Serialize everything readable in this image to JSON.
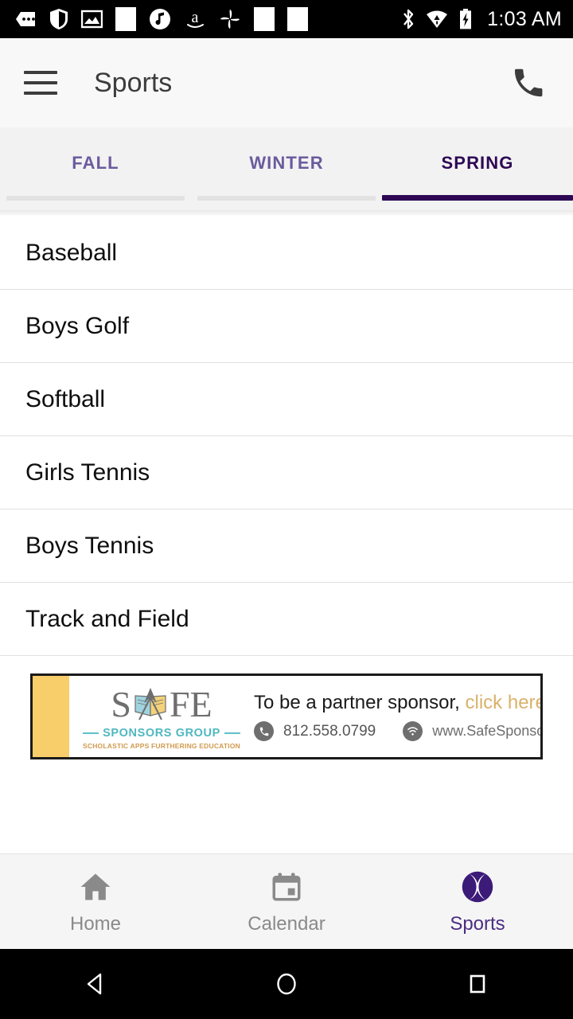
{
  "status_bar": {
    "time": "1:03 AM",
    "left_icons": [
      {
        "name": "messages-icon"
      },
      {
        "name": "shield-icon"
      },
      {
        "name": "photo-icon"
      },
      {
        "name": "blank-app-icon"
      },
      {
        "name": "music-note-icon"
      },
      {
        "name": "amazon-icon"
      },
      {
        "name": "pinwheel-photos-icon"
      },
      {
        "name": "blank-app-icon-2"
      },
      {
        "name": "blank-app-icon-3"
      }
    ],
    "right_icons": [
      {
        "name": "bluetooth-icon"
      },
      {
        "name": "wifi-alert-icon"
      },
      {
        "name": "battery-charging-icon"
      }
    ]
  },
  "appbar": {
    "menu_icon": "hamburger-menu-icon",
    "title": "Sports",
    "phone_icon": "phone-icon"
  },
  "tabs": {
    "items": [
      {
        "label": "FALL",
        "active": false
      },
      {
        "label": "WINTER",
        "active": false
      },
      {
        "label": "SPRING",
        "active": true
      }
    ],
    "active_color": "#2E0854",
    "inactive_color": "#6B5B9E"
  },
  "sports_list": [
    {
      "label": "Baseball"
    },
    {
      "label": "Boys Golf"
    },
    {
      "label": "Softball"
    },
    {
      "label": "Girls Tennis"
    },
    {
      "label": "Boys Tennis"
    },
    {
      "label": "Track and Field"
    }
  ],
  "ad": {
    "logo": {
      "letter_s": "S",
      "letter_f": "F",
      "letter_e": "E",
      "book_icon": "open-book-icon",
      "subtitle": "SPONSORS GROUP",
      "tagline": "SCHOLASTIC APPS FURTHERING EDUCATION"
    },
    "headline_main": "To be a partner sponsor,",
    "headline_cta": "click here!",
    "phone": "812.558.0799",
    "website": "www.SafeSponsors.com",
    "phone_icon": "phone-circle-icon",
    "wifi_icon": "wifi-circle-icon",
    "left_bar_color": "#F8CE6B",
    "right_bar_color": "#A8DDE2",
    "cta_color": "#D8B26A"
  },
  "bottom_nav": {
    "items": [
      {
        "label": "Home",
        "icon": "home-icon",
        "active": false
      },
      {
        "label": "Calendar",
        "icon": "calendar-icon",
        "active": false
      },
      {
        "label": "Sports",
        "icon": "sports-ball-icon",
        "active": true
      }
    ],
    "active_color": "#4B2E83",
    "inactive_color": "#8A8A8A"
  },
  "android_nav": {
    "back": "back-triangle-icon",
    "home": "home-circle-icon",
    "recents": "recents-square-icon"
  }
}
